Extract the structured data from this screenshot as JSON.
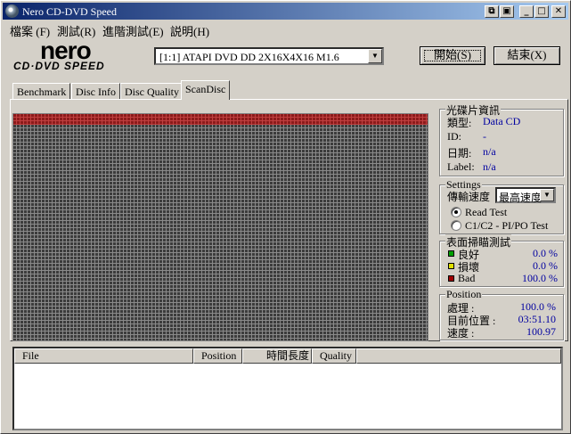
{
  "window": {
    "title": "Nero CD-DVD Speed"
  },
  "titlebar_buttons": [
    "⧉",
    "▣",
    "_",
    "□",
    "✕"
  ],
  "menu": [
    "檔案 (F)",
    "測試(R)",
    "進階測試(E)",
    "説明(H)"
  ],
  "logo": {
    "brand": "nero",
    "product": "CD·DVD SPEED"
  },
  "drive": {
    "selected": "[1:1]   ATAPI DVD DD 2X16X4X16 M1.6"
  },
  "buttons": {
    "start": "開始(S)",
    "exit": "結束(X)"
  },
  "tabs": [
    "Benchmark",
    "Disc Info",
    "Disc Quality",
    "ScanDisc"
  ],
  "active_tab": "ScanDisc",
  "disc_info": {
    "title": "光碟片資訊",
    "type_label": "類型:",
    "type_value": "Data CD",
    "id_label": "ID:",
    "id_value": "-",
    "date_label": "日期:",
    "date_value": "n/a",
    "label_label": "Label:",
    "label_value": "n/a"
  },
  "settings": {
    "title": "Settings",
    "speed_label": "傳輸速度",
    "speed_value": "最高速度",
    "read_test": "Read Test",
    "c1c2_test": "C1/C2 - PI/PO Test",
    "selected": "read_test"
  },
  "surface": {
    "title": "表面掃瞄測試",
    "good_label": "良好",
    "good_value": "0.0 %",
    "good_color": "#00a000",
    "damaged_label": "損壞",
    "damaged_value": "0.0 %",
    "damaged_color": "#e0e000",
    "bad_label": "Bad",
    "bad_value": "100.0 %",
    "bad_color": "#a00000"
  },
  "position": {
    "title": "Position",
    "processed_label": "處理 :",
    "processed_value": "100.0 %",
    "current_label": "目前位置 :",
    "current_value": "03:51.10",
    "speed_label": "速度 :",
    "speed_value": "100.97"
  },
  "scan": {
    "bad_fraction": 1.0
  },
  "file_list": {
    "columns": [
      "File",
      "Position",
      "時間長度",
      "Quality"
    ],
    "rows": []
  }
}
